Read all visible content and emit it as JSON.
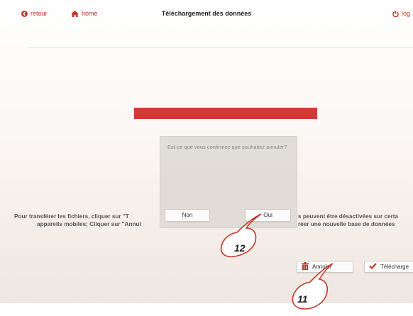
{
  "nav": {
    "back_label": "retour",
    "home_label": "home",
    "title": "Téléchargement des données",
    "logout_label": "log"
  },
  "progress": {
    "fraction": 1.0,
    "color": "#d03a34"
  },
  "instructions": {
    "left_line1": "Pour transférer les fichiers, cliquer sur \"T",
    "left_line2": "appareils mobiles; Cliquer sur \"Annul",
    "right_line1": "s peuvent être désactivées sur certa",
    "right_line2": "réer une nouvelle base de données"
  },
  "dialog": {
    "message": "Est-ce que vous confirmez que souhaitez annuler?",
    "no_label": "Non",
    "yes_label": "Oui"
  },
  "actions": {
    "cancel_label": "Annuler",
    "download_label": "Télécharge"
  },
  "callouts": {
    "first": "11",
    "second": "12"
  },
  "colors": {
    "accent": "#c0392b",
    "progress": "#d03a34"
  }
}
